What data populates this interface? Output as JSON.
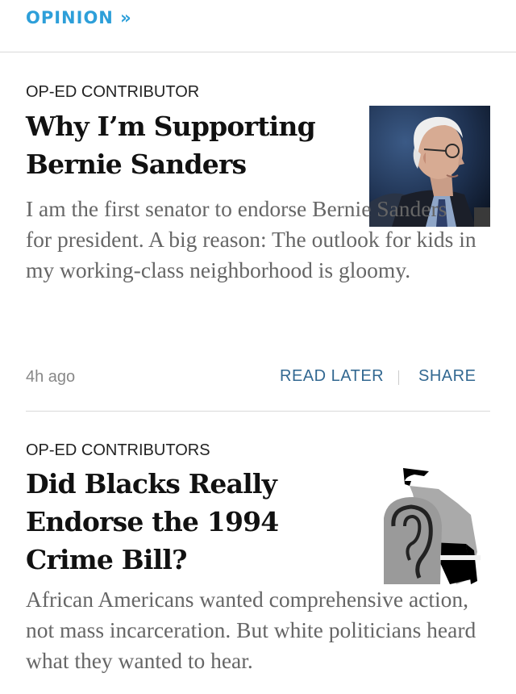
{
  "section": {
    "label": "OPINION »",
    "accent_color": "#2d9fd9"
  },
  "articles": [
    {
      "kicker": "OP-ED CONTRIBUTOR",
      "headline": "Why I’m Supporting Bernie Sanders",
      "summary": "I am the first senator to endorse Bernie Sanders for president. A big reason: The outlook for kids in my working-class neighborhood is gloomy.",
      "timestamp": "4h ago",
      "actions": {
        "read_later": "READ LATER",
        "share": "SHARE"
      },
      "thumbnail": "photo-bernie-sanders"
    },
    {
      "kicker": "OP-ED CONTRIBUTORS",
      "headline": "Did Blacks Really Endorse the 1994 Crime Bill?",
      "summary": "African Americans wanted comprehensive action, not mass incarceration. But white politicians heard what they wanted to hear.",
      "thumbnail": "illustration-crime-bill"
    }
  ],
  "colors": {
    "action_link": "#326891",
    "summary_text": "#666666",
    "rule": "#d9d9d9"
  }
}
